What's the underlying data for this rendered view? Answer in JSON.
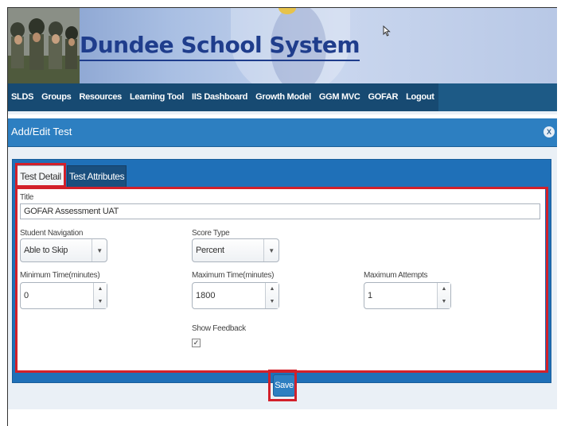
{
  "site": {
    "title": "Dundee School System"
  },
  "nav": {
    "items": [
      {
        "label": "SLDS"
      },
      {
        "label": "Groups"
      },
      {
        "label": "Resources"
      },
      {
        "label": "Learning Tool"
      },
      {
        "label": "IIS Dashboard"
      },
      {
        "label": "Growth Model"
      },
      {
        "label": "GGM MVC"
      },
      {
        "label": "GOFAR"
      },
      {
        "label": "Logout"
      }
    ]
  },
  "dialog": {
    "title": "Add/Edit Test",
    "close_icon": "X",
    "tabs": [
      {
        "label": "Test Detail",
        "active": true
      },
      {
        "label": "Test Attributes",
        "active": false
      }
    ],
    "form": {
      "title_label": "Title",
      "title_value": "GOFAR Assessment UAT",
      "student_nav_label": "Student Navigation",
      "student_nav_value": "Able to Skip",
      "score_type_label": "Score Type",
      "score_type_value": "Percent",
      "min_time_label": "Minimum Time(minutes)",
      "min_time_value": "0",
      "max_time_label": "Maximum Time(minutes)",
      "max_time_value": "1800",
      "max_attempts_label": "Maximum Attempts",
      "max_attempts_value": "1",
      "show_feedback_label": "Show Feedback",
      "show_feedback_checked": true
    },
    "save_label": "Save"
  },
  "colors": {
    "nav_bg": "#1d5a86",
    "dialog_header": "#2d7fc1",
    "panel": "#1f70b8",
    "highlight": "#d2202a"
  }
}
